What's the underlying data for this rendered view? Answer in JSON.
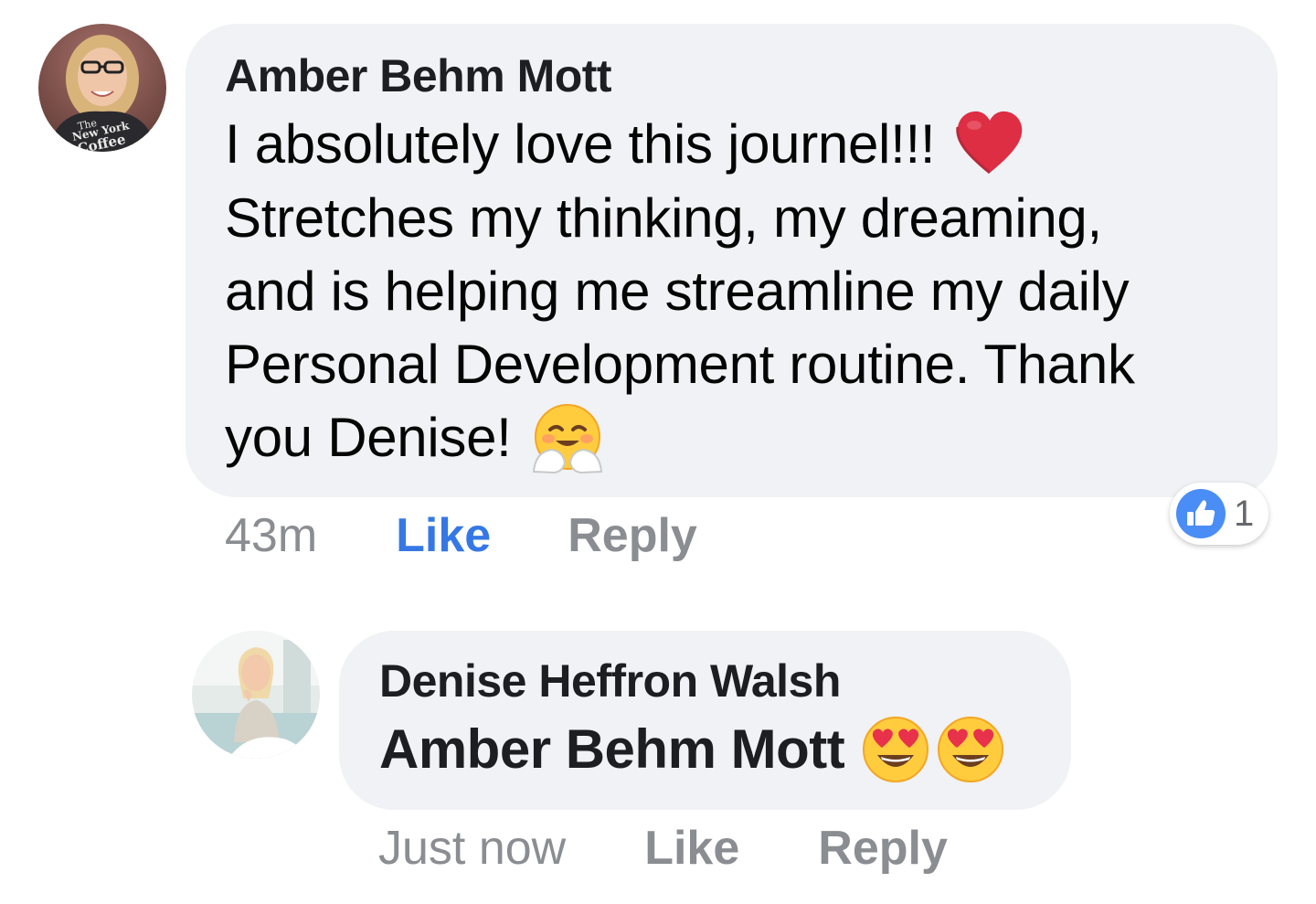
{
  "comments": [
    {
      "author": "Amber Behm Mott",
      "avatar_shirt_text": "The New York Coffee",
      "text_lines": [
        "I absolutely love this journel!!!",
        "Stretches my thinking, my dreaming,",
        "and is helping me streamline my daily",
        "Personal Development routine. Thank",
        "you Denise!"
      ],
      "emojis": [
        "red-heart-emoji",
        "hugging-face-emoji"
      ],
      "time": "43m",
      "like_label": "Like",
      "reply_label": "Reply",
      "liked": true,
      "reactions": {
        "icon": "thumbs-up-icon",
        "count": "1",
        "color": "#4a8df6"
      }
    },
    {
      "author": "Denise Heffron Walsh",
      "mention": "Amber Behm Mott",
      "emojis": [
        "heart-eyes-emoji",
        "heart-eyes-emoji"
      ],
      "time": "Just now",
      "like_label": "Like",
      "reply_label": "Reply",
      "liked": false
    }
  ],
  "colors": {
    "bubble": "#f0f2f5",
    "like_active": "#3578e5",
    "meta_gray": "#8a8d91"
  }
}
